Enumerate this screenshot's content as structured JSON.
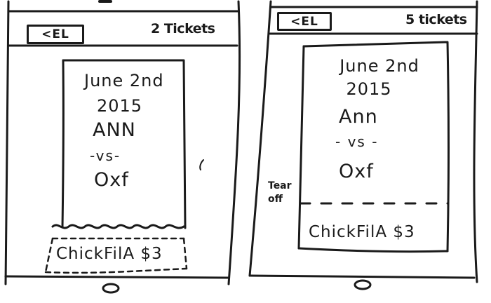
{
  "screens": [
    {
      "header": {
        "back_label": "<EL",
        "ticket_count": "2 Tickets"
      },
      "ticket": {
        "date": "June 2nd",
        "year": "2015",
        "home": "ANN",
        "vs": "-vs-",
        "away": "Oxf"
      },
      "coupon": {
        "text": "ChickFilA $3"
      }
    },
    {
      "header": {
        "back_label": "<EL",
        "ticket_count": "5 tickets"
      },
      "ticket": {
        "date": "June 2nd",
        "year": "2015",
        "home": "Ann",
        "vs": "- vs -",
        "away": "Oxf"
      },
      "coupon": {
        "text": "ChickFilA $3"
      },
      "note": {
        "line1": "Tear",
        "line2": "off"
      }
    }
  ]
}
